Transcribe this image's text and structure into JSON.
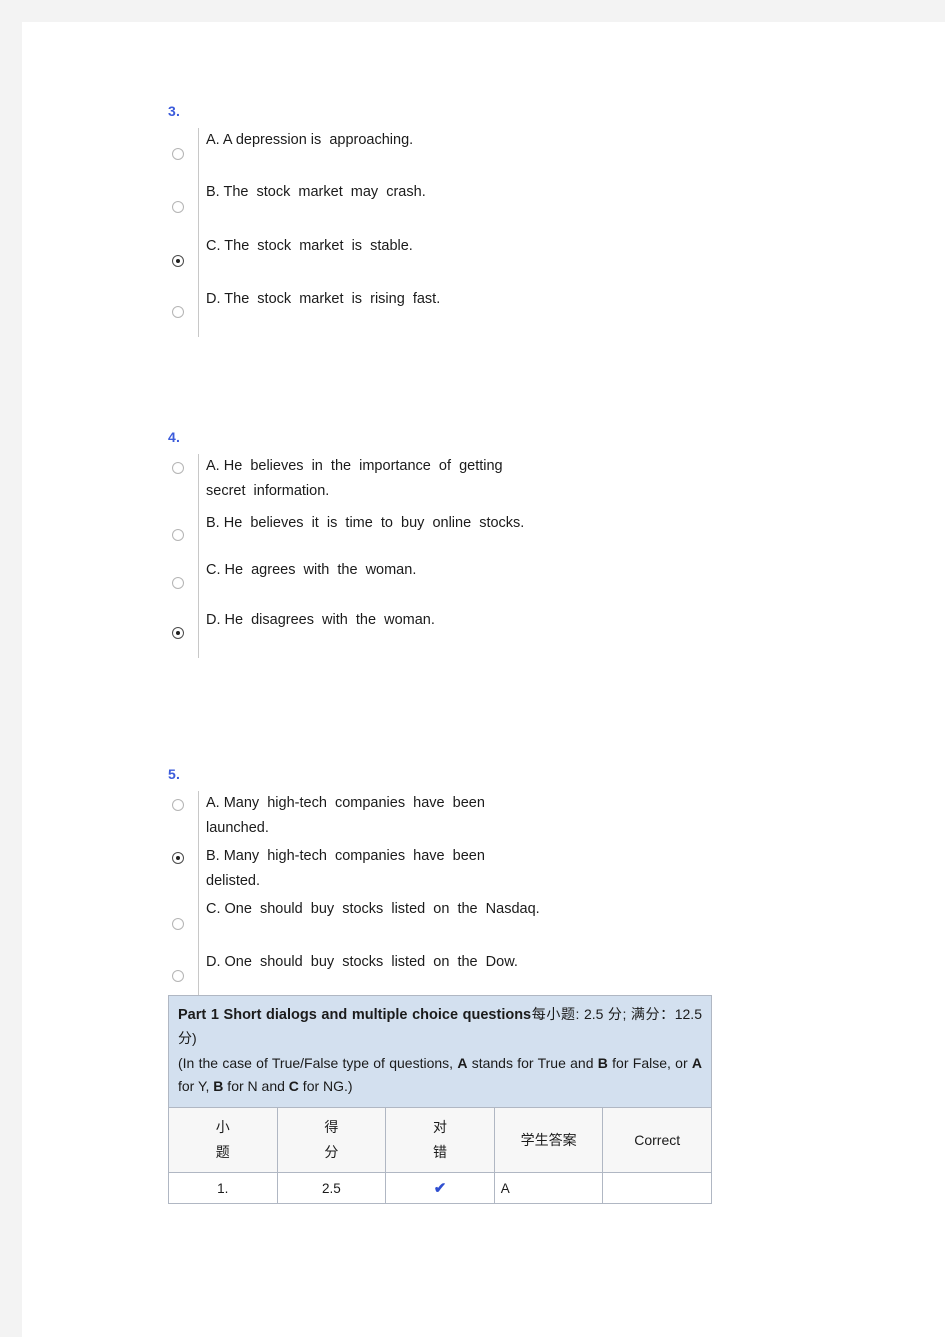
{
  "page": {
    "background_color": "#ffffff",
    "chrome_color": "#f3f3f3",
    "question_number_color": "#3b5bdb",
    "header_fill_color": "#d3e0ef"
  },
  "questions": [
    {
      "number": "3.",
      "options": [
        {
          "label": "A. A depression is  approaching.",
          "checked": false
        },
        {
          "label": "B. The  stock  market  may  crash.",
          "checked": false
        },
        {
          "label": "C. The  stock  market  is  stable.",
          "checked": true
        },
        {
          "label": "D. The  stock  market  is  rising  fast.",
          "checked": false
        }
      ]
    },
    {
      "number": "4.",
      "options": [
        {
          "label": "A. He  believes  in  the  importance  of  getting\nsecret  information.",
          "checked": false
        },
        {
          "label": "B. He  believes  it  is  time  to  buy  online  stocks.",
          "checked": false
        },
        {
          "label": "C. He  agrees  with  the  woman.",
          "checked": false
        },
        {
          "label": "D. He  disagrees  with  the  woman.",
          "checked": true
        }
      ]
    },
    {
      "number": "5.",
      "options": [
        {
          "label": "A. Many  high-tech  companies  have  been\nlaunched.",
          "checked": false
        },
        {
          "label": "B. Many  high-tech  companies  have  been\ndelisted.",
          "checked": true
        },
        {
          "label": "C. One  should  buy  stocks  listed  on  the  Nasdaq.",
          "checked": false
        },
        {
          "label": "D. One  should  buy  stocks  listed  on  the  Dow.",
          "checked": false
        }
      ]
    }
  ],
  "result_table": {
    "part_title": "Part 1 Short  dialogs  and  multiple  choice  questions",
    "part_score": "每小题: 2.5  分;  满分：12.5  分)",
    "part_note_html": "(In  the  case  of  True/False  type  of  questions,  A  stands  for  True  and  B  for False,  or  A  for  Y,  B  for  N  and  C  for  NG.)",
    "part_note_plain": "(In the case of True/False type of questions, A stands for True and B for False, or A for Y, B for N and C for NG.)",
    "headers": {
      "number_line1": "小",
      "number_line2": "题",
      "score_line1": "得",
      "score_line2": "分",
      "correctness_line1": "对",
      "correctness_line2": "错",
      "student_answer": "学生答案",
      "correct": "Correct"
    },
    "rows": [
      {
        "number": "1.",
        "score": "2.5",
        "mark": "✔",
        "student_answer": "A",
        "correct_answer": ""
      }
    ]
  }
}
